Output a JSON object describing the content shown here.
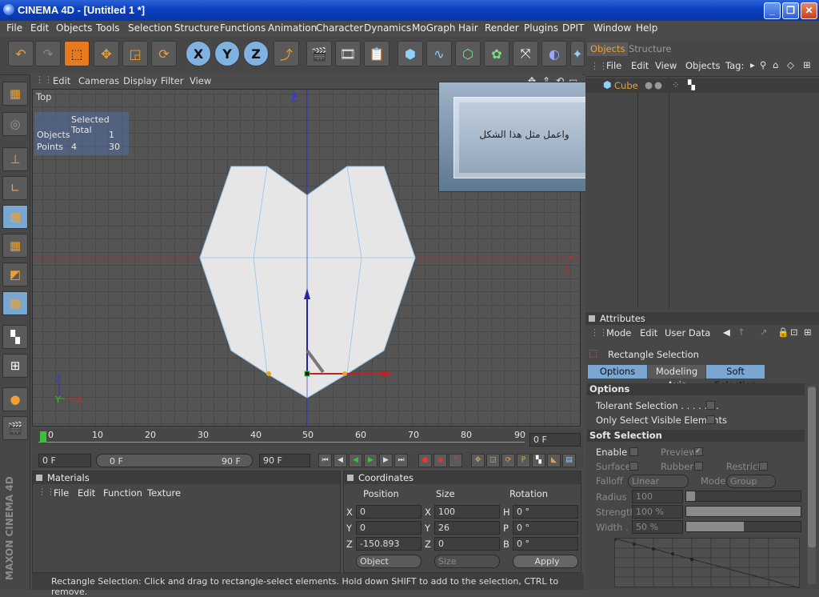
{
  "window": {
    "title": "CINEMA 4D - [Untitled 1 *]"
  },
  "menu": [
    "File",
    "Edit",
    "Objects",
    "Tools",
    "Selection",
    "Structure",
    "Functions",
    "Animation",
    "Character",
    "Dynamics",
    "MoGraph",
    "Hair",
    "Render",
    "Plugins",
    "DPIT",
    "Window",
    "Help"
  ],
  "toolbar": {
    "axis_x": "X",
    "axis_y": "Y",
    "axis_z": "Z"
  },
  "viewport": {
    "menu": [
      "Edit",
      "Cameras",
      "Display",
      "Filter",
      "View"
    ],
    "view_name": "Top",
    "stats": {
      "header": "Selected Total",
      "rows": [
        {
          "label": "Objects",
          "selected": "",
          "total": "1"
        },
        {
          "label": "Points",
          "selected": "4",
          "total": "30"
        }
      ]
    },
    "axis_labels": {
      "z": "Z",
      "x": "X",
      "mini_z": "Z",
      "mini_y": "Y",
      "mini_x": "X"
    }
  },
  "overlay": {
    "text": "واعمل مثل هذا الشكل"
  },
  "timeline": {
    "ticks": [
      "0",
      "10",
      "20",
      "30",
      "40",
      "50",
      "60",
      "70",
      "80",
      "90"
    ],
    "current_frame": "0 F"
  },
  "timectl": {
    "start": "0 F",
    "range_start": "0 F",
    "range_end": "90 F",
    "end": "90 F"
  },
  "materials": {
    "title": "Materials",
    "menu": [
      "File",
      "Edit",
      "Function",
      "Texture"
    ]
  },
  "coords": {
    "title": "Coordinates",
    "headers": [
      "Position",
      "Size",
      "Rotation"
    ],
    "rows": [
      {
        "pos_label": "X",
        "pos": "0",
        "size_label": "X",
        "size": "100",
        "rot_label": "H",
        "rot": "0 °"
      },
      {
        "pos_label": "Y",
        "pos": "0",
        "size_label": "Y",
        "size": "26",
        "rot_label": "P",
        "rot": "0 °"
      },
      {
        "pos_label": "Z",
        "pos": "-150.893",
        "size_label": "Z",
        "size": "0",
        "rot_label": "B",
        "rot": "0 °"
      }
    ],
    "mode": "Object",
    "size_mode": "Size",
    "apply": "Apply"
  },
  "objects": {
    "tabs": [
      "Objects",
      "Structure"
    ],
    "menu": [
      "File",
      "Edit",
      "View",
      "Objects",
      "Tag:"
    ],
    "items": [
      {
        "name": "Cube"
      }
    ]
  },
  "attributes": {
    "title": "Attributes",
    "menu": [
      "Mode",
      "Edit",
      "User Data"
    ],
    "tool_name": "Rectangle Selection",
    "tabs": [
      "Options",
      "Modeling Axis",
      "Soft Selection"
    ],
    "options_header": "Options",
    "tolerant": "Tolerant Selection . . . . . . .",
    "visible_only": "Only Select Visible Elements",
    "soft_header": "Soft Selection",
    "enable": "Enable",
    "preview": "Preview",
    "surface": "Surface",
    "rubber": "Rubber",
    "restrict": "Restrict",
    "falloff": "Falloff",
    "falloff_val": "Linear",
    "mode": "Mode",
    "mode_val": "Group",
    "radius": "Radius",
    "radius_val": "100",
    "strength": "Strength",
    "strength_val": "100 %",
    "width": "Width . .",
    "width_val": "50 %"
  },
  "status": {
    "text": "Rectangle Selection: Click and drag to rectangle-select elements. Hold down SHIFT to add to the selection, CTRL to remove."
  },
  "branding": {
    "logo": "MAXON CINEMA 4D"
  }
}
